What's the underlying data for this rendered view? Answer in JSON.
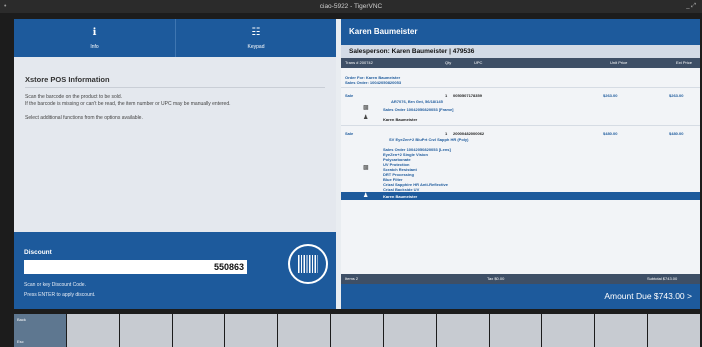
{
  "window": {
    "title": "ciao-5922 - TigerVNC",
    "app_glyph": "•",
    "controls": "_ ⤢"
  },
  "nav": {
    "tabs": [
      {
        "label": "Info",
        "icon": "info-icon",
        "glyph": "ℹ"
      },
      {
        "label": "Keypad",
        "icon": "keypad-icon",
        "glyph": "☷"
      }
    ]
  },
  "info": {
    "title": "Xstore POS Information",
    "lines": [
      "Scan the barcode on the product to be sold.",
      "If the barcode is missing or can't be read, the item number or UPC may be manually entered.",
      "Select additional functions from the options available."
    ]
  },
  "discount": {
    "title": "Discount",
    "value": "550863",
    "hint1": "Scan or key Discount Code.",
    "hint2": "Press ENTER to apply discount.",
    "icon": "barcode-icon"
  },
  "customer": {
    "name": "Karen Baumeister"
  },
  "salesperson": {
    "label": "Salesperson:",
    "value": "Karen Baumeister | 479536"
  },
  "table": {
    "headers": {
      "trans": "Trans # 200742",
      "qty": "Qty",
      "upc": "UPC",
      "unit": "Unit Price",
      "ext": "Ext Price"
    }
  },
  "order": {
    "for": "Order For: Karen Baumeister",
    "sales_order": "Sales Order: 10042050820053"
  },
  "items": [
    {
      "type": "Sale",
      "qty": "1",
      "upc": "0050507178359",
      "unit": "$263.00",
      "ext": "$263.00",
      "desc": "AR7076, Brn Gnt, 56/18/145",
      "order_line": "Sales Order 10042050820053 [Frame]",
      "person": "Karen Baumeister"
    },
    {
      "type": "Sale",
      "qty": "1",
      "upc": "20000482000062",
      "unit": "$480.00",
      "ext": "$480.00",
      "desc": "SV EyeZen+2 BluPrt Crzl Sapph HR (Poly)",
      "details": [
        "Sales Order 10042050820053 [Lens]",
        "EyeZen+2 Single Vision",
        "Polycarbonate",
        "UV Protection",
        "Scratch Resistant",
        "DRT Processing",
        "Blue Filter",
        "Crizal Sapphire HR Anti-Reflective",
        "Crizal Backside UV"
      ],
      "person": "Karen Baumeister"
    }
  ],
  "totals": {
    "items": "Items 2",
    "tax": "Tax $0.00",
    "subtotal": "Subtotal $743.00"
  },
  "amount_due": {
    "label": "Amount Due $743.00",
    "chevron": ">"
  },
  "fkeys": [
    {
      "top": "Back",
      "bottom": "Esc"
    },
    {
      "top": "",
      "bottom": ""
    },
    {
      "top": "",
      "bottom": ""
    },
    {
      "top": "",
      "bottom": ""
    },
    {
      "top": "",
      "bottom": ""
    },
    {
      "top": "",
      "bottom": ""
    },
    {
      "top": "",
      "bottom": ""
    },
    {
      "top": "",
      "bottom": ""
    },
    {
      "top": "",
      "bottom": ""
    },
    {
      "top": "",
      "bottom": ""
    },
    {
      "top": "",
      "bottom": ""
    },
    {
      "top": "",
      "bottom": ""
    },
    {
      "top": "",
      "bottom": ""
    }
  ],
  "colors": {
    "accent": "#1d5a9c",
    "header_dark": "#3e4f66",
    "panel": "#e4e8ee"
  }
}
